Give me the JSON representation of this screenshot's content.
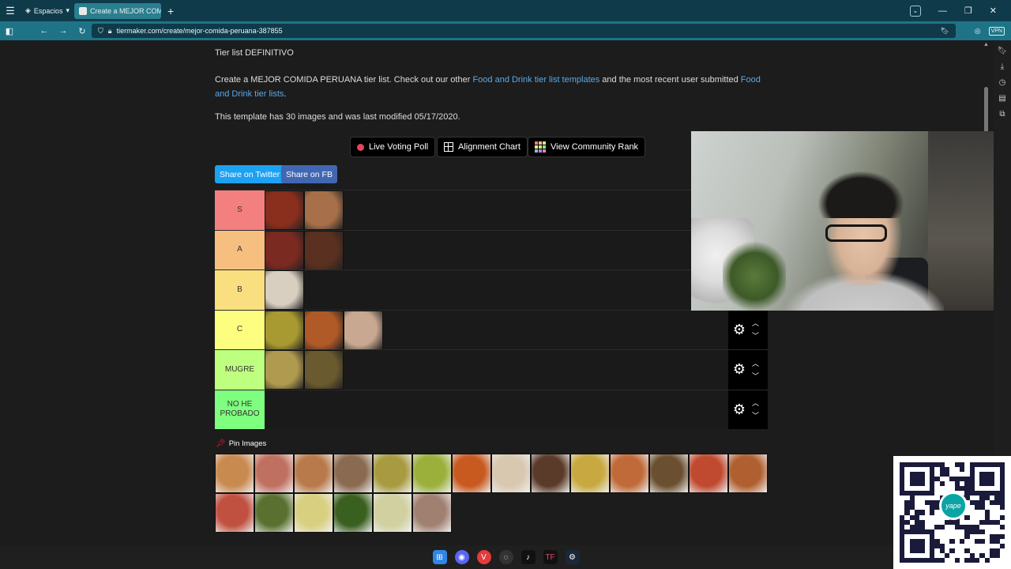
{
  "browser": {
    "workspace_label": "Espacios",
    "tab_title": "Create a MEJOR COMIDA P",
    "url": "tiermaker.com/create/mejor-comida-peruana-387855",
    "vpn_label": "VPN"
  },
  "page": {
    "subtitle": "Tier list DEFINITIVO",
    "desc_prefix": "Create a MEJOR COMIDA PERUANA tier list. Check out our other ",
    "desc_link1": "Food and Drink tier list templates",
    "desc_middle": " and the most recent user submitted ",
    "desc_link2": "Food and Drink tier lists",
    "desc_suffix": ".",
    "info": "This template has 30 images and was last modified 05/17/2020.",
    "buttons": {
      "live_voting": "Live Voting Poll",
      "alignment": "Alignment Chart",
      "community": "View Community Rank"
    },
    "share_twitter": "Share on Twitter",
    "share_fb": "Share on FB",
    "pin_label": "Pin Images"
  },
  "tiers": [
    {
      "label": "S",
      "color": "#f47f7f",
      "images": [
        "#8a2e1e",
        "#a8704a"
      ]
    },
    {
      "label": "A",
      "color": "#f7bf7f",
      "images": [
        "#7a2a20",
        "#5a3020"
      ]
    },
    {
      "label": "B",
      "color": "#f9df7f",
      "images": [
        "#d8cfc0"
      ]
    },
    {
      "label": "C",
      "color": "#fdfe7f",
      "images": [
        "#a89a30",
        "#b05a28",
        "#c8a890"
      ]
    },
    {
      "label": "MUGRE",
      "color": "#bfff7f",
      "images": [
        "#b09a50",
        "#6a5a30"
      ]
    },
    {
      "label": "NO HE PROBADO",
      "color": "#7fff7f",
      "images": []
    }
  ],
  "pool_images": [
    "#c98a50",
    "#c07060",
    "#b87a4a",
    "#8a6a50",
    "#a89a40",
    "#9ab03a",
    "#c85a20",
    "#d8c8b0",
    "#5a3a28",
    "#c8a840",
    "#c06a3a",
    "#6a5030",
    "#c04a30",
    "#b06030",
    "#c05040",
    "#5a7030",
    "#d8d080",
    "#3a6020",
    "#d0d0a0",
    "#a08070"
  ],
  "qr": {
    "badge": "yape"
  },
  "colors": {
    "accent": "#1da1f2",
    "fb": "#4267b2",
    "link": "#5ba8e8"
  }
}
